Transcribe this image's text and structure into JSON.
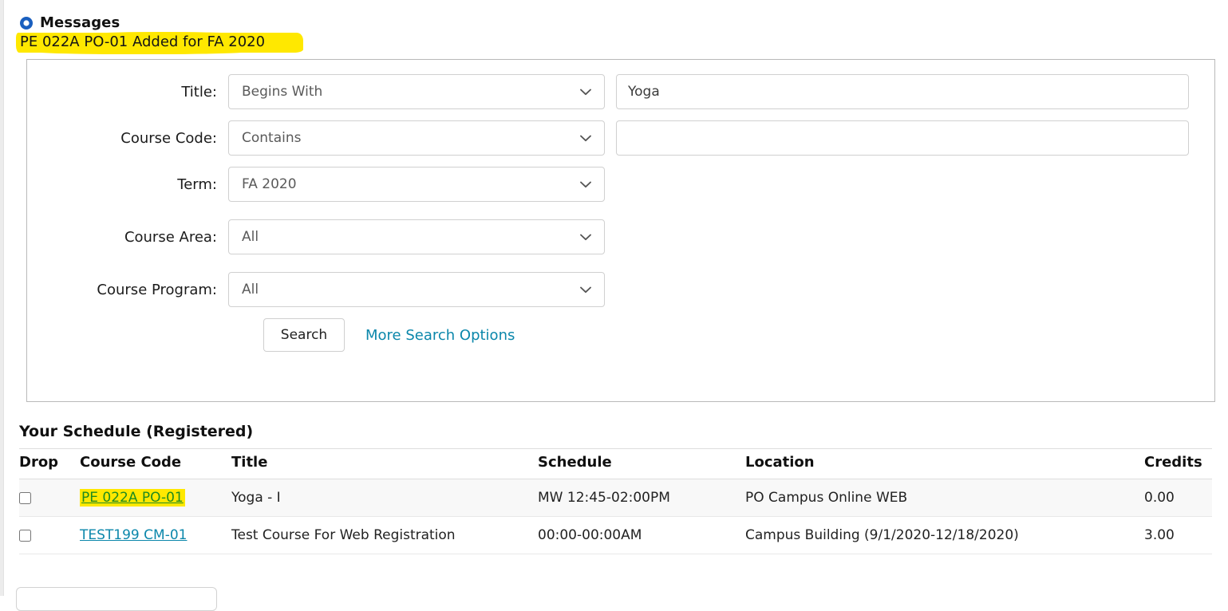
{
  "messages": {
    "icon": "info-circle-icon",
    "title": "Messages",
    "text": "PE 022A PO-01 Added for FA 2020",
    "highlight_color": "#ffe800"
  },
  "search_form": {
    "rows": [
      {
        "label": "Title:",
        "operator": "Begins With",
        "value": "Yoga",
        "has_text_input": true
      },
      {
        "label": "Course Code:",
        "operator": "Contains",
        "value": "",
        "has_text_input": true
      },
      {
        "label": "Term:",
        "operator": "FA 2020",
        "value": "",
        "has_text_input": false
      },
      {
        "label": "Course Area:",
        "operator": "All",
        "value": "",
        "has_text_input": false
      },
      {
        "label": "Course Program:",
        "operator": "All",
        "value": "",
        "has_text_input": false
      }
    ],
    "search_button": "Search",
    "more_options_link": "More Search Options",
    "link_color": "#0b87ab"
  },
  "schedule": {
    "heading": "Your Schedule (Registered)",
    "columns": [
      "Drop",
      "Course Code",
      "Title",
      "Schedule",
      "Location",
      "Credits"
    ],
    "rows": [
      {
        "code": "PE 022A PO-01",
        "title": "Yoga - I",
        "schedule": "MW 12:45-02:00PM",
        "location": "PO Campus Online WEB",
        "credits": "0.00",
        "highlighted": true
      },
      {
        "code": "TEST199 CM-01",
        "title": "Test Course For Web Registration",
        "schedule": "00:00-00:00AM",
        "location": "Campus Building (9/1/2020-12/18/2020)",
        "credits": "3.00",
        "highlighted": false
      }
    ]
  }
}
